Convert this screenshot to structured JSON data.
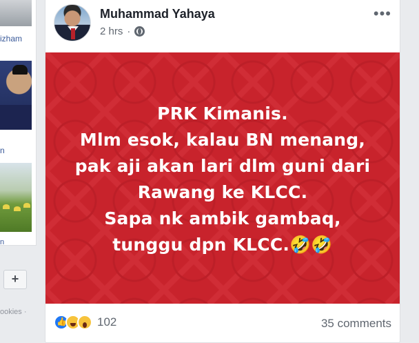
{
  "sidebar": {
    "names": [
      "izham",
      "n",
      "n"
    ],
    "add_label": "+",
    "footer_text": "ookies ·"
  },
  "post": {
    "author": "Muhammad Yahaya",
    "time": "2 hrs",
    "separator": "·",
    "more_label": "•••",
    "image_lines": [
      "PRK Kimanis.",
      "Mlm esok, kalau BN menang,",
      "pak aji akan lari dlm guni dari",
      "Rawang ke KLCC.",
      "Sapa nk ambik gambaq,",
      "tunggu dpn KLCC.🤣🤣"
    ],
    "image_bg_color": "#c8232c",
    "reactions": [
      "like",
      "haha",
      "wow"
    ],
    "reaction_count": "102",
    "comments": "35 comments"
  }
}
